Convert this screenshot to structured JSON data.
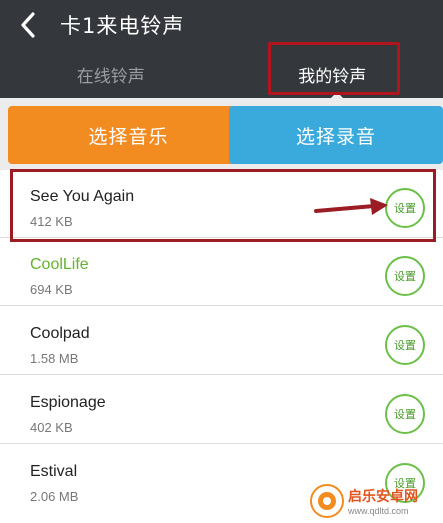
{
  "header": {
    "title": "卡1来电铃声",
    "back_icon": "chevron-left-icon"
  },
  "tabs": [
    {
      "label": "在线铃声",
      "active": false
    },
    {
      "label": "我的铃声",
      "active": true
    }
  ],
  "actions": {
    "music_label": "选择音乐",
    "record_label": "选择录音"
  },
  "songs": [
    {
      "title": "See You Again",
      "size": "412 KB",
      "set_label": "设置"
    },
    {
      "title": "CoolLife",
      "size": "694 KB",
      "set_label": "设置"
    },
    {
      "title": "Coolpad",
      "size": "1.58 MB",
      "set_label": "设置"
    },
    {
      "title": "Espionage",
      "size": "402 KB",
      "set_label": "设置"
    },
    {
      "title": "Estival",
      "size": "2.06 MB",
      "set_label": "设置"
    }
  ],
  "watermark": {
    "name": "启乐安卓网",
    "url": "www.qdltd.com"
  },
  "colors": {
    "header_bg": "#34383d",
    "music_button": "#f28b20",
    "record_button": "#3aa9dc",
    "set_button_border": "#6cc04a",
    "highlight_red": "#9b1d23",
    "active_song_green": "#64b32e"
  }
}
